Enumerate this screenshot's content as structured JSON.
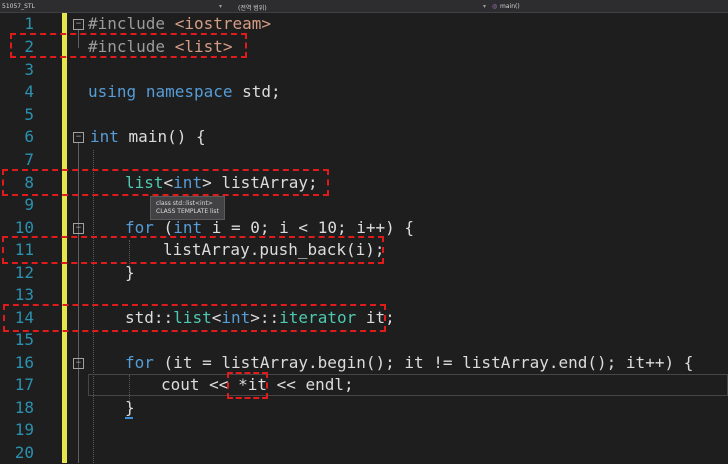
{
  "toolbar": {
    "project": "51057_STL",
    "scope": "(전역 범위)",
    "function": "main()"
  },
  "line_numbers": [
    "1",
    "2",
    "3",
    "4",
    "5",
    "6",
    "7",
    "8",
    "9",
    "10",
    "11",
    "12",
    "13",
    "14",
    "15",
    "16",
    "17",
    "18",
    "19",
    "20"
  ],
  "code": {
    "l1_pp": "#include",
    "l1_inc": "<iostream>",
    "l2_pp": "#include",
    "l2_inc": "<list>",
    "l4_using": "using",
    "l4_namespace": "namespace",
    "l4_rest": "std;",
    "l6_int": "int",
    "l6_rest": "main() {",
    "l8_list": "list",
    "l8_lt": "<",
    "l8_int": "int",
    "l8_rest": "> listArray;",
    "l10_for": "for",
    "l10_paren": "(",
    "l10_int": "int",
    "l10_rest": "i = 0; i < 10; i++) {",
    "l11": "listArray.push_back(i);",
    "l12": "}",
    "l14_std": "std::",
    "l14_list": "list",
    "l14_lt": "<",
    "l14_int": "int",
    "l14_mid": ">::",
    "l14_iterator": "iterator",
    "l14_rest": "it;",
    "l16_for": "for",
    "l16_rest": "(it = listArray.begin(); it != listArray.end(); it++) {",
    "l17_a": "cout << ",
    "l17_b": "*it",
    "l17_c": " << endl;",
    "l18": "}"
  },
  "tooltip": {
    "line1": "class std::list<int>",
    "line2": "CLASS TEMPLATE list"
  },
  "colors": {
    "line_number": "#2b91af",
    "keyword": "#569cd6",
    "type": "#4ec9b0",
    "highlight_box": "#e01b1b",
    "change_bar": "#e6e64c"
  }
}
